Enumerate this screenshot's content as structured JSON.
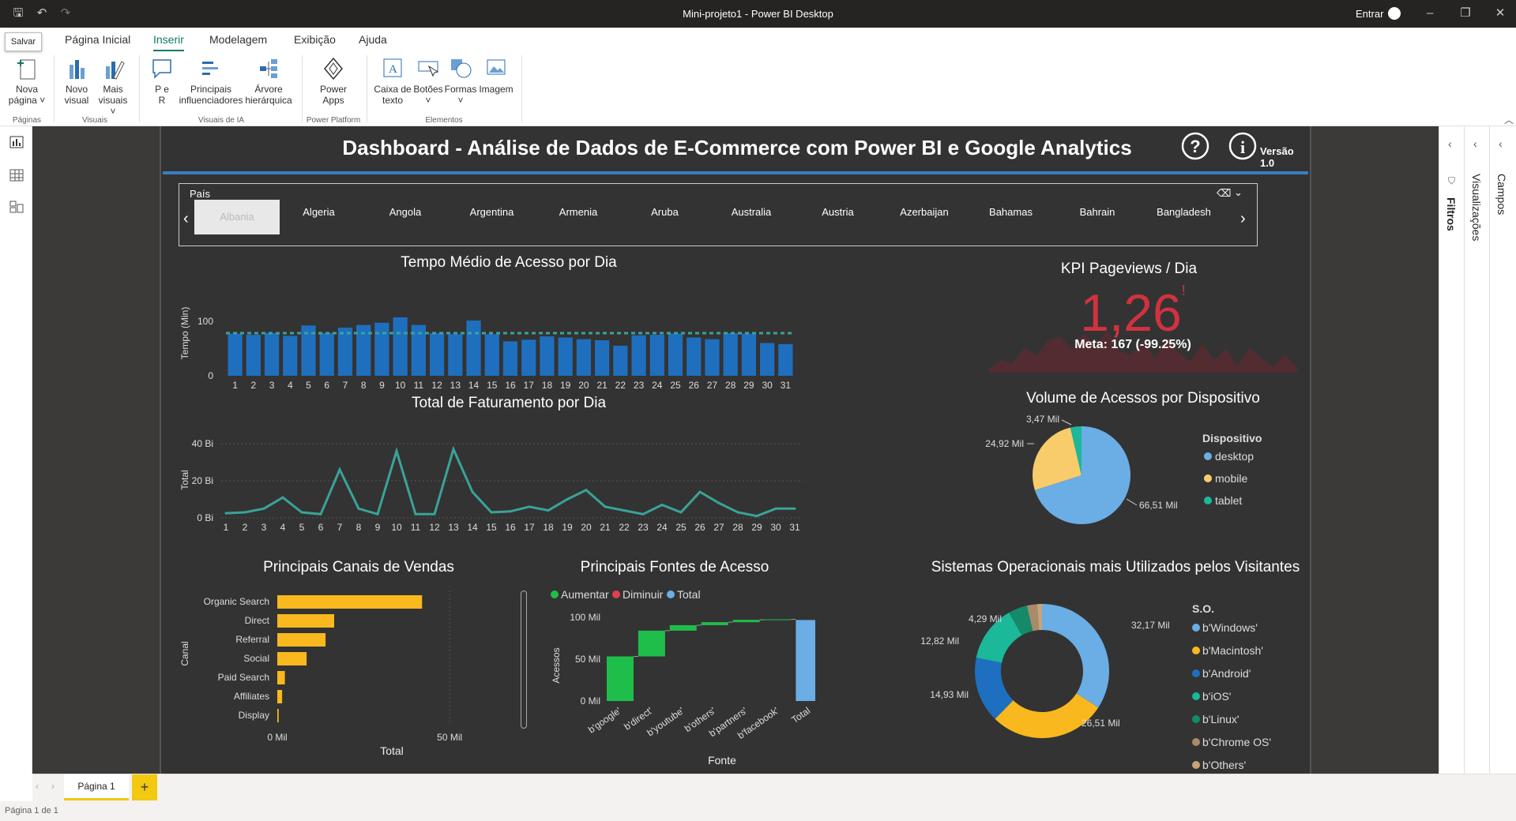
{
  "window": {
    "title": "Mini-projeto1 - Power BI Desktop",
    "signin": "Entrar",
    "tooltip": "Salvar"
  },
  "menu": [
    "Página Inicial",
    "Inserir",
    "Modelagem",
    "Exibição",
    "Ajuda"
  ],
  "ribbon": {
    "buttons": {
      "nova_pagina": "Nova\npágina ˅",
      "novo_visual": "Novo\nvisual",
      "mais_visuais": "Mais\nvisuais ˅",
      "pe_r": "P e\nR",
      "principais": "Principais\ninfluenciadores",
      "arvore": "Árvore\nhierárquica",
      "power_apps": "Power\nApps",
      "caixa_texto": "Caixa de\ntexto",
      "botoes": "Botões\n˅",
      "formas": "Formas\n˅",
      "imagem": "Imagem"
    },
    "groups": {
      "paginas": "Páginas",
      "visuais": "Visuais",
      "visuais_ia": "Visuais de IA",
      "power_platform": "Power Platform",
      "elementos": "Elementos"
    }
  },
  "panes": {
    "filtros": "Filtros",
    "visualizacoes": "Visualizações",
    "campos": "Campos"
  },
  "report": {
    "title": "Dashboard - Análise de Dados de E-Commerce com Power BI e Google Analytics",
    "version": "Versão 1.0",
    "slicer": {
      "label": "País",
      "items": [
        "Albania",
        "Algeria",
        "Angola",
        "Argentina",
        "Armenia",
        "Aruba",
        "Australia",
        "Austria",
        "Azerbaijan",
        "Bahamas",
        "Bahrain",
        "Bangladesh"
      ]
    },
    "kpi": {
      "title": "KPI Pageviews / Dia",
      "value": "1,26",
      "meta": "Meta: 167 (-99.25%)",
      "warn": "!"
    }
  },
  "tabs": {
    "page1": "Página 1",
    "add": "+"
  },
  "status": "Página 1 de 1",
  "chart_data": [
    {
      "id": "tempo",
      "type": "bar",
      "title": "Tempo Médio de Acesso por Dia",
      "ylabel": "Tempo (Min)",
      "ylim": [
        0,
        130
      ],
      "yticks": [
        "100",
        "0"
      ],
      "yticks_v": [
        100,
        0
      ],
      "categories": [
        "1",
        "2",
        "3",
        "4",
        "5",
        "6",
        "7",
        "8",
        "9",
        "10",
        "11",
        "12",
        "13",
        "14",
        "15",
        "16",
        "17",
        "18",
        "19",
        "20",
        "21",
        "22",
        "23",
        "24",
        "25",
        "26",
        "27",
        "28",
        "29",
        "30",
        "31"
      ],
      "values": [
        77,
        75,
        78,
        73,
        92,
        78,
        88,
        93,
        97,
        107,
        93,
        78,
        76,
        101,
        76,
        63,
        66,
        72,
        70,
        67,
        65,
        55,
        74,
        75,
        77,
        70,
        67,
        78,
        77,
        60,
        58
      ],
      "reference": 78,
      "color": "#1f6fbf"
    },
    {
      "id": "fat",
      "type": "line",
      "title": "Total de Faturamento por Dia",
      "ylabel": "Total",
      "ylim": [
        0,
        40
      ],
      "yticks": [
        "40 Bi",
        "20 Bi",
        "0 Bi"
      ],
      "yticks_v": [
        40,
        20,
        0
      ],
      "categories": [
        "1",
        "2",
        "3",
        "4",
        "5",
        "6",
        "7",
        "8",
        "9",
        "10",
        "11",
        "12",
        "13",
        "14",
        "15",
        "16",
        "17",
        "18",
        "19",
        "20",
        "21",
        "22",
        "23",
        "24",
        "25",
        "26",
        "27",
        "28",
        "29",
        "30",
        "31"
      ],
      "values": [
        2.5,
        3,
        5,
        11,
        3,
        2,
        26,
        5,
        2,
        36,
        2,
        2,
        37,
        14,
        3,
        3.5,
        6,
        4,
        10,
        15,
        6,
        4,
        2,
        7,
        3,
        14,
        8,
        3,
        1,
        5,
        5
      ],
      "color": "#3aa398"
    },
    {
      "id": "disp",
      "type": "pie",
      "title": "Volume de Acessos por Dispositivo",
      "legend_title": "Dispositivo",
      "labels": [
        "desktop",
        "mobile",
        "tablet"
      ],
      "values": [
        66.51,
        24.92,
        3.47
      ],
      "value_labels": [
        "66,51 Mil",
        "24,92 Mil",
        "3,47 Mil"
      ],
      "colors": [
        "#6aaee5",
        "#f8cc6a",
        "#1bb89a"
      ]
    },
    {
      "id": "canais",
      "type": "bar",
      "orientation": "horizontal",
      "title": "Principais Canais de Vendas",
      "xlabel": "Total",
      "ylabel": "Canal",
      "xticks": [
        "0 Mil",
        "50 Mil"
      ],
      "xlim": [
        0,
        55
      ],
      "categories": [
        "Organic Search",
        "Direct",
        "Referral",
        "Social",
        "Paid Search",
        "Affiliates",
        "Display"
      ],
      "values": [
        42,
        16.5,
        14,
        8.5,
        2.2,
        1.4,
        0.4
      ],
      "color": "#f8b81e"
    },
    {
      "id": "fontes",
      "type": "waterfall",
      "title": "Principais Fontes de Acesso",
      "xlabel": "Fonte",
      "ylabel": "Acessos",
      "legend": [
        "Aumentar",
        "Diminuir",
        "Total"
      ],
      "legend_colors": [
        "#1fbe4a",
        "#e0404f",
        "#6aaee5"
      ],
      "yticks": [
        "100 Mil",
        "50 Mil",
        "0 Mil"
      ],
      "yticks_v": [
        100,
        50,
        0
      ],
      "ylim": [
        0,
        100
      ],
      "categories": [
        "b'google'",
        "b'direct'",
        "b'youtube'",
        "b'others'",
        "b'partners'",
        "b'facebook'",
        "Total"
      ],
      "values": [
        53.3,
        30.8,
        6.5,
        3.6,
        2.8,
        0.6,
        96.8
      ]
    },
    {
      "id": "so",
      "type": "donut",
      "title": "Sistemas Operacionais mais Utilizados pelos Visitantes",
      "legend_title": "S.O.",
      "labels": [
        "b'Windows'",
        "b'Macintosh'",
        "b'Android'",
        "b'iOS'",
        "b'Linux'",
        "b'Chrome OS'",
        "b'Others'"
      ],
      "values": [
        32.17,
        26.51,
        14.93,
        12.82,
        4.29,
        2.3,
        1.1
      ],
      "value_labels": [
        "32,17 Mil",
        "26,51 Mil",
        "14,93 Mil",
        "12,82 Mil",
        "4,29 Mil"
      ],
      "colors": [
        "#6aaee5",
        "#f8b81e",
        "#1e6fbf",
        "#1bb89a",
        "#148a6a",
        "#a88b6a",
        "#c8a478"
      ]
    }
  ]
}
